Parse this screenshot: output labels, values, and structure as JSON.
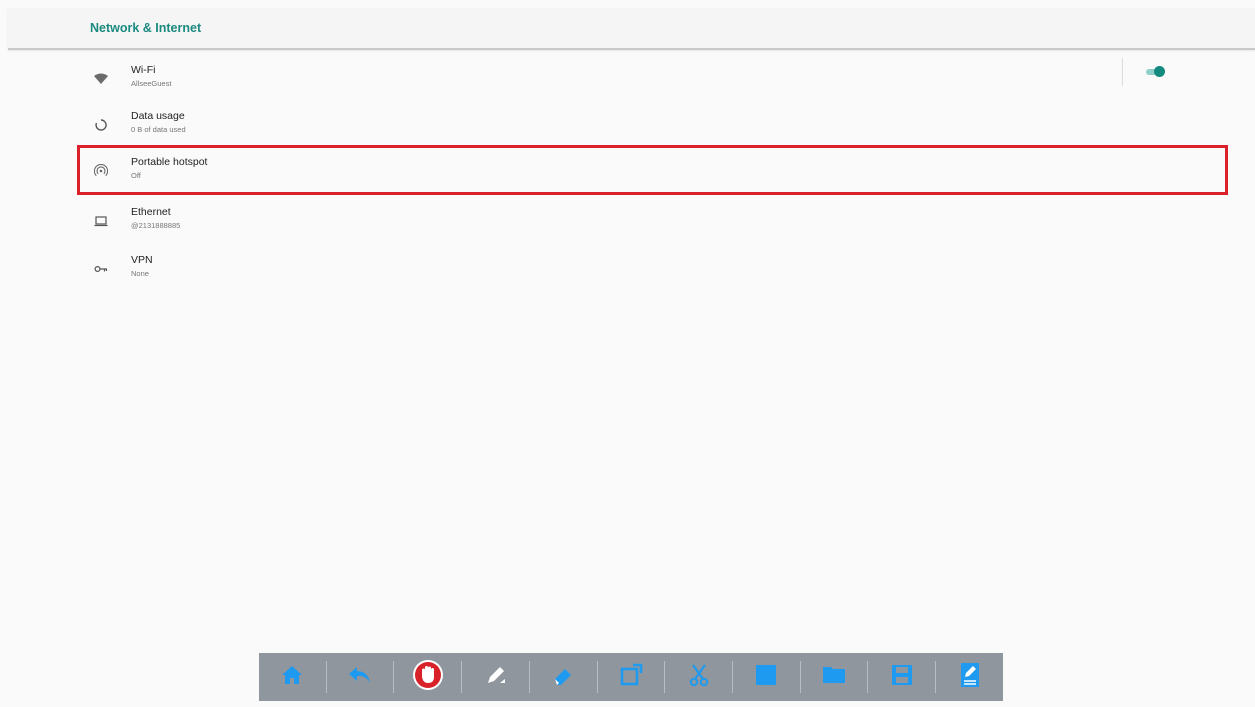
{
  "header": {
    "title": "Network & Internet"
  },
  "items": [
    {
      "icon": "wifi-icon",
      "title": "Wi-Fi",
      "subtitle": "AllseeGuest",
      "toggle": true
    },
    {
      "icon": "data-usage-icon",
      "title": "Data usage",
      "subtitle": "0 B of data used"
    },
    {
      "icon": "hotspot-icon",
      "title": "Portable hotspot",
      "subtitle": "Off"
    },
    {
      "icon": "ethernet-icon",
      "title": "Ethernet",
      "subtitle": "@2131888885"
    },
    {
      "icon": "vpn-key-icon",
      "title": "VPN",
      "subtitle": "None"
    }
  ],
  "highlight_color": "#d9202b",
  "accent_color": "#1b8a80",
  "toolbar": {
    "buttons": [
      "home-icon",
      "undo-icon",
      "hand-stop-icon",
      "pen-icon",
      "eraser-icon",
      "crop-icon",
      "scissors-icon",
      "whiteboard-icon",
      "folder-icon",
      "save-icon",
      "note-edit-icon"
    ],
    "color": "#8f969d"
  }
}
